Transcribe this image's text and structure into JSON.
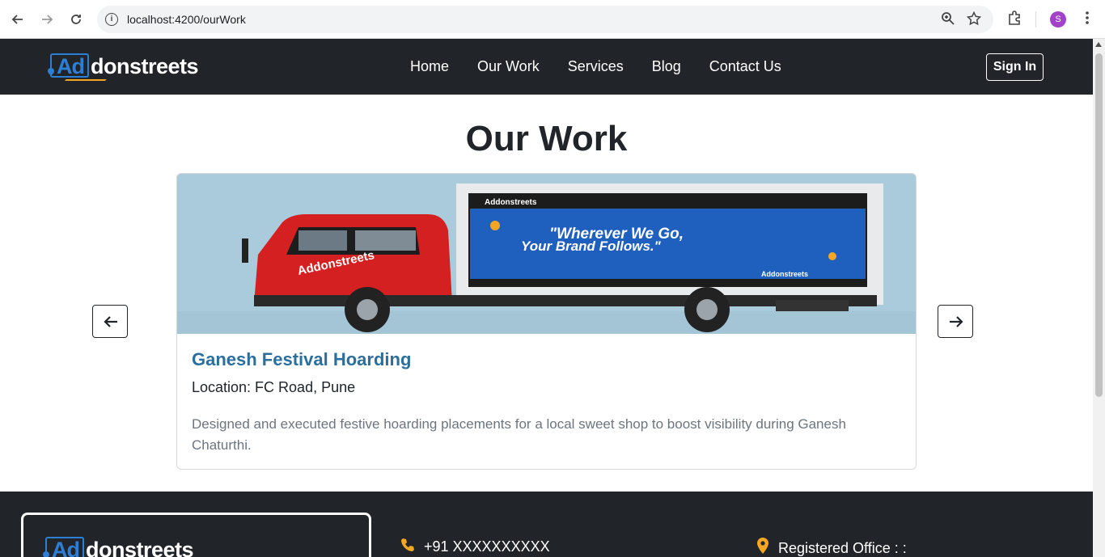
{
  "browser": {
    "url": "localhost:4200/ourWork",
    "profile_initial": "S"
  },
  "navbar": {
    "logo_ad": "Ad",
    "logo_rest": "donstreets",
    "menu": [
      "Home",
      "Our Work",
      "Services",
      "Blog",
      "Contact Us"
    ],
    "signin_label": "Sign In"
  },
  "main": {
    "heading": "Our Work",
    "card": {
      "title": "Ganesh Festival Hoarding",
      "location": "Location: FC Road, Pune",
      "description": "Designed and executed festive hoarding placements for a local sweet shop to boost visibility during Ganesh Chaturthi.",
      "image": {
        "truck_logo": "Addonstreets",
        "banner_line1": "\"Wherever We Go,",
        "banner_line2": "Your Brand Follows.\"",
        "banner_logo": "Addonstreets"
      }
    }
  },
  "footer": {
    "logo_ad": "Ad",
    "logo_rest": "donstreets",
    "phone": "+91 XXXXXXXXXX",
    "office_label": "Registered Office : :"
  },
  "colors": {
    "navbar_bg": "#212529",
    "brand_blue": "#2d7fd6",
    "card_title": "#2b6f9e",
    "accent_orange": "#f5a623"
  }
}
